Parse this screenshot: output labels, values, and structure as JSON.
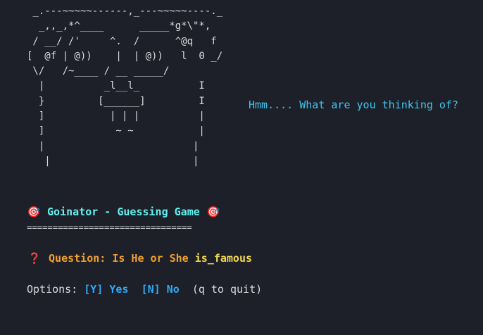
{
  "ascii_art": " _.---~~~~~------,_---~~~~~----._\n  _,,_,*^____      _____*g*\\\"*,\n / __/ /'     ^.  /      ^@q   f\n[  @f | @))    |  | @))   l  0 _/\n \\/   /~____ / __ _____/\n  |          _l__l_          I\n  }         [______]         I\n  ]           | | |          |\n  ]            ~ ~           |\n  |                         |\n   |                        |",
  "speech_bubble": "Hmm.... What are you thinking of?",
  "title": {
    "left_icon": "🎯",
    "text": "Goinator - Guessing Game",
    "right_icon": "🎯"
  },
  "separator": "================================",
  "question": {
    "icon": "❓",
    "prefix": "Question: Is He or She ",
    "attribute": "is_famous"
  },
  "options": {
    "label": "Options: ",
    "yes": "[Y] Yes",
    "no": "[N] No",
    "quit": "(q to quit)"
  },
  "colors": {
    "background": "#1e2029",
    "bubble": "#3ec5f0",
    "title": "#5ff0f0",
    "question": "#f0a030",
    "attribute": "#f2d94e",
    "option_keys": "#2ea8f5"
  }
}
